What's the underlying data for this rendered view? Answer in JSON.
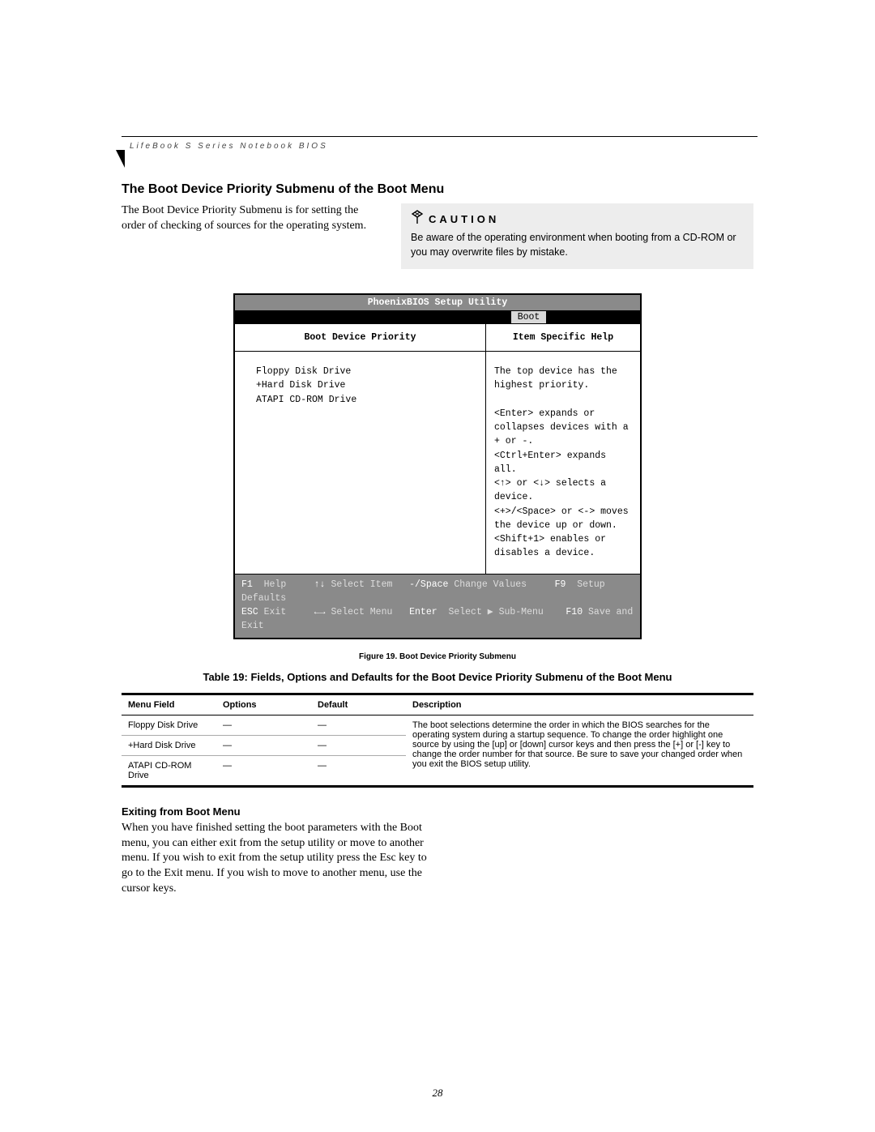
{
  "running_header": "LifeBook S Series Notebook BIOS",
  "section_title": "The Boot Device Priority Submenu of the Boot Menu",
  "intro_text": "The Boot Device Priority Submenu is for setting the order of checking of sources for the operating system.",
  "caution": {
    "label": "CAUTION",
    "body": "Be aware of the operating environment when booting from a CD-ROM or you may overwrite files by mistake."
  },
  "bios": {
    "title": "PhoenixBIOS Setup Utility",
    "active_tab": "Boot",
    "left_header": "Boot Device Priority",
    "right_header": "Item Specific Help",
    "devices": [
      "Floppy Disk Drive",
      "+Hard Disk Drive",
      " ATAPI CD-ROM Drive"
    ],
    "help_text": "The top device has the highest priority.\n\n<Enter> expands or collapses devices with a + or -.\n<Ctrl+Enter> expands all.\n<↑> or <↓> selects a device.\n<+>/<Space> or <-> moves the device up or down.\n<Shift+1> enables or disables a device.",
    "footer": {
      "f1": "F1",
      "f1_label": "Help",
      "arrows_ud": "↑↓",
      "arrows_ud_label": "Select Item",
      "minus_space": "-/Space",
      "minus_space_label": "Change Values",
      "f9": "F9",
      "f9_label": "Setup Defaults",
      "esc": "ESC",
      "esc_label": "Exit",
      "arrows_lr": "←→",
      "arrows_lr_label": "Select Menu",
      "enter": "Enter",
      "enter_label": "Select ▶ Sub-Menu",
      "f10": "F10",
      "f10_label": "Save and Exit"
    }
  },
  "figure_caption": "Figure 19.  Boot Device Priority Submenu",
  "table_caption": "Table 19: Fields, Options and Defaults for the Boot Device Priority Submenu of the Boot Menu",
  "table": {
    "headers": {
      "menu_field": "Menu Field",
      "options": "Options",
      "default": "Default",
      "description": "Description"
    },
    "rows": [
      {
        "menu_field": "Floppy Disk Drive",
        "options": "—",
        "default": "—"
      },
      {
        "menu_field": "+Hard Disk Drive",
        "options": "—",
        "default": "—"
      },
      {
        "menu_field": "ATAPI CD-ROM Drive",
        "options": "—",
        "default": "—"
      }
    ],
    "description": "The boot selections determine the order in which the BIOS searches for the operating system during a startup sequence. To change the order highlight one source by using the [up] or [down] cursor keys and then press the [+] or [-] key to change the order number for that source. Be sure to save your changed order when you exit the BIOS setup utility."
  },
  "subsection_title": "Exiting from Boot Menu",
  "subsection_body": "When you have finished setting the boot parameters with the Boot menu, you can either exit from the setup utility or move to another menu. If you wish to exit from the setup utility press the Esc key to go to the Exit menu. If you wish to move to another menu, use the cursor keys.",
  "page_number": "28"
}
